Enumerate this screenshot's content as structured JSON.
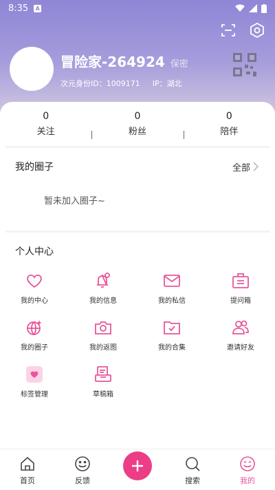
{
  "status_bar": {
    "time": "8:35",
    "notif_letter": "A"
  },
  "profile": {
    "name": "冒险家-264924",
    "gender": "保密",
    "id_label": "次元身份ID：1009171",
    "ip_label": "IP：湖北"
  },
  "stats": [
    {
      "value": "0",
      "label": "关注"
    },
    {
      "value": "0",
      "label": "粉丝"
    },
    {
      "value": "0",
      "label": "陪伴"
    }
  ],
  "circles": {
    "title": "我的圈子",
    "all_label": "全部",
    "empty_text": "暂未加入圈子~"
  },
  "personal": {
    "title": "个人中心",
    "items": [
      {
        "label": "我的中心",
        "icon": "heart-icon"
      },
      {
        "label": "我的信息",
        "icon": "bell-icon"
      },
      {
        "label": "我的私信",
        "icon": "mail-icon"
      },
      {
        "label": "提问箱",
        "icon": "briefcase-icon"
      },
      {
        "label": "我的圈子",
        "icon": "globe-icon"
      },
      {
        "label": "我的返图",
        "icon": "camera-icon"
      },
      {
        "label": "我的合集",
        "icon": "folder-check-icon"
      },
      {
        "label": "邀请好友",
        "icon": "users-icon"
      },
      {
        "label": "标签管理",
        "icon": "tag-heart-icon"
      },
      {
        "label": "草稿箱",
        "icon": "draft-icon"
      }
    ]
  },
  "tabbar": [
    {
      "label": "首页",
      "icon": "home-icon"
    },
    {
      "label": "反馈",
      "icon": "smile-icon"
    },
    {
      "label": "",
      "icon": "plus-icon"
    },
    {
      "label": "搜索",
      "icon": "search-icon"
    },
    {
      "label": "我的",
      "icon": "smile-active-icon"
    }
  ],
  "colors": {
    "accent": "#e8559a",
    "header_top": "#8f86d6",
    "fab": "#ec3d86"
  }
}
